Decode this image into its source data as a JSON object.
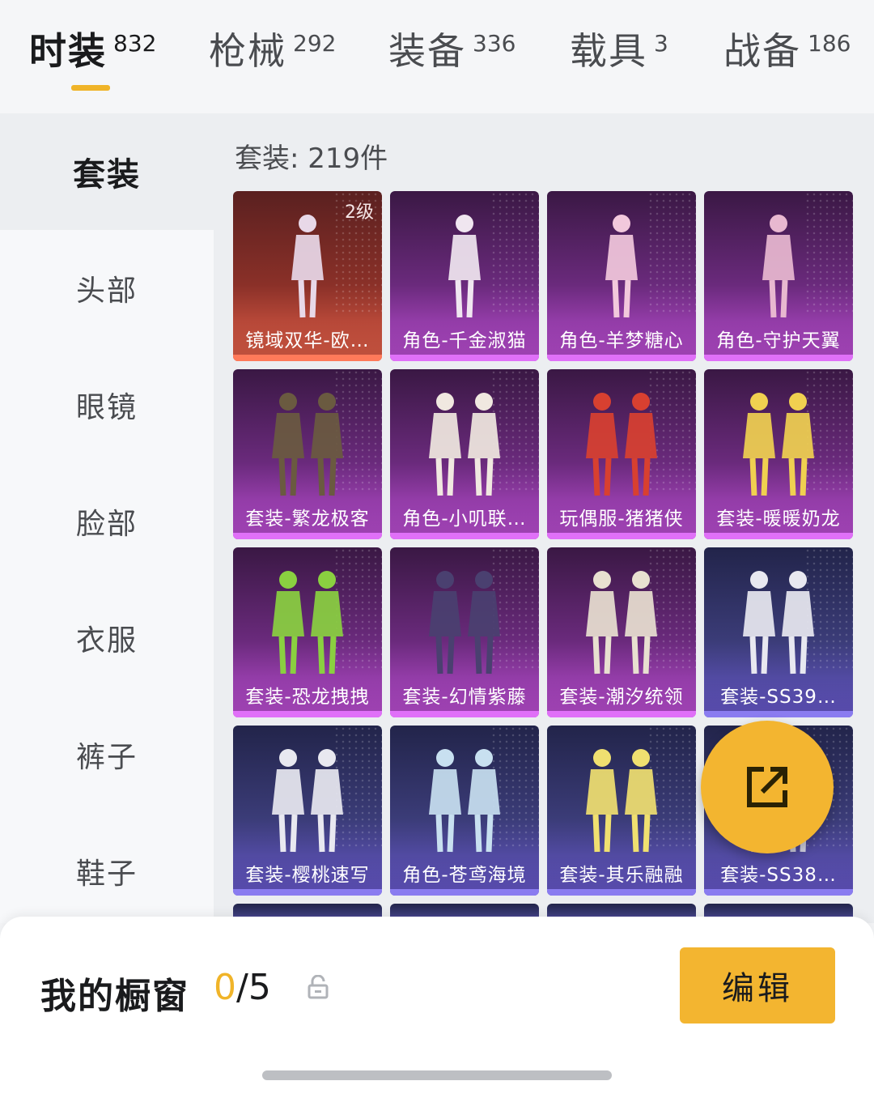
{
  "tabs": [
    {
      "label": "时装",
      "count": "832"
    },
    {
      "label": "枪械",
      "count": "292"
    },
    {
      "label": "装备",
      "count": "336"
    },
    {
      "label": "载具",
      "count": "3"
    },
    {
      "label": "战备",
      "count": "186"
    }
  ],
  "sidebar": {
    "items": [
      "套装",
      "头部",
      "眼镜",
      "脸部",
      "衣服",
      "裤子",
      "鞋子"
    ]
  },
  "main": {
    "count_text": "套装: 219件"
  },
  "cards": [
    {
      "label": "镜域双华-欧…",
      "level": "2级",
      "theme": "red"
    },
    {
      "label": "角色-千金淑猫",
      "theme": "purple"
    },
    {
      "label": "角色-羊梦糖心",
      "theme": "purple"
    },
    {
      "label": "角色-守护天翼",
      "theme": "purple"
    },
    {
      "label": "套装-繁龙极客",
      "theme": "purple"
    },
    {
      "label": "角色-小叽联…",
      "theme": "purple"
    },
    {
      "label": "玩偶服-猪猪侠",
      "theme": "purple"
    },
    {
      "label": "套装-暖暖奶龙",
      "theme": "purple"
    },
    {
      "label": "套装-恐龙拽拽",
      "theme": "purple"
    },
    {
      "label": "套装-幻情紫藤",
      "theme": "purple"
    },
    {
      "label": "套装-潮汐统领",
      "theme": "purple"
    },
    {
      "label": "套装-SS39…",
      "theme": "blue"
    },
    {
      "label": "套装-樱桃速写",
      "theme": "blue"
    },
    {
      "label": "角色-苍鸢海境",
      "theme": "blue"
    },
    {
      "label": "套装-其乐融融",
      "theme": "blue"
    },
    {
      "label": "套装-SS38…",
      "theme": "blue"
    }
  ],
  "bottom": {
    "title": "我的橱窗",
    "current": "0",
    "total": "/5",
    "edit_label": "编辑"
  },
  "colors": {
    "accent": "#f3b530",
    "purple_card": "#6a2a7c",
    "blue_card": "#3b3c78",
    "red_card": "#8a3028"
  }
}
